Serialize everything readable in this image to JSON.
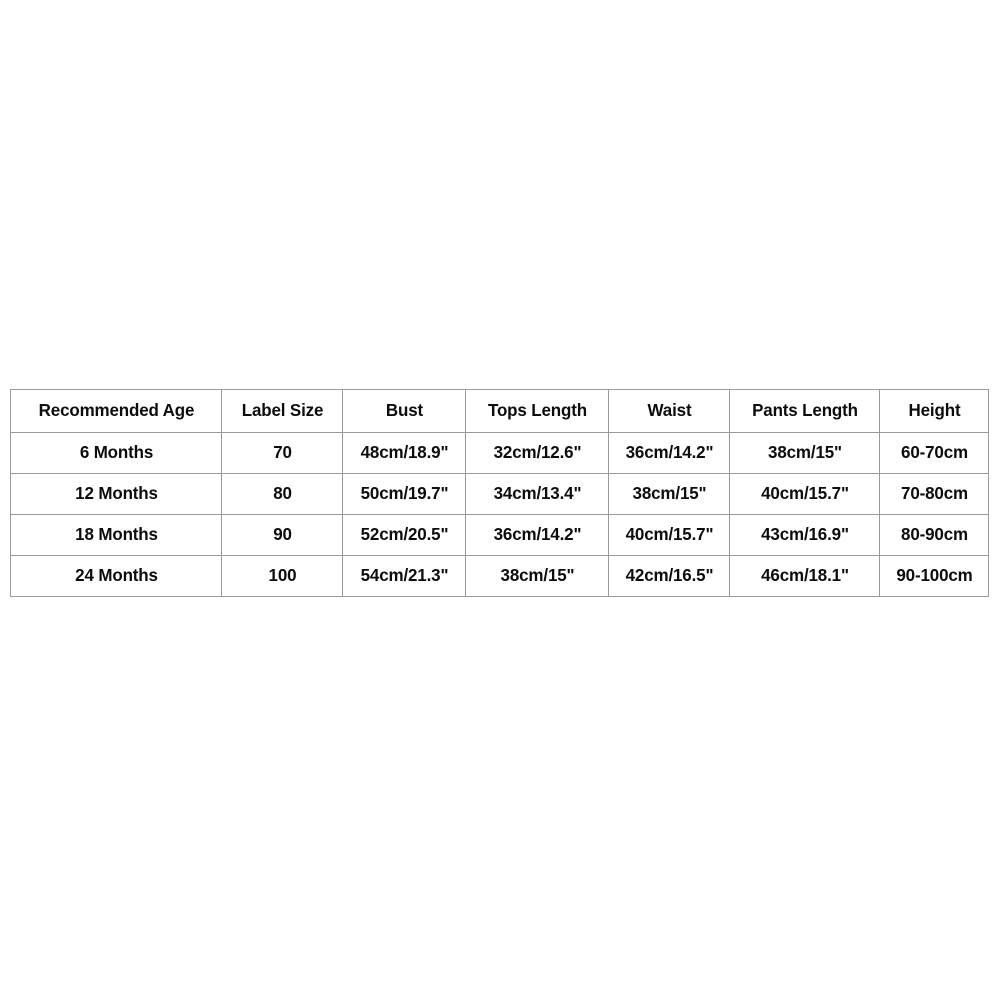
{
  "page": {
    "background_color": "#ffffff",
    "text_color": "#0d0d0d",
    "border_color": "#9a9a9a"
  },
  "table": {
    "name": "baby-clothing-size-chart",
    "columns": [
      {
        "key": "age",
        "label": "Recommended Age"
      },
      {
        "key": "label",
        "label": "Label Size"
      },
      {
        "key": "bust",
        "label": "Bust"
      },
      {
        "key": "tops",
        "label": "Tops Length"
      },
      {
        "key": "waist",
        "label": "Waist"
      },
      {
        "key": "pants",
        "label": "Pants Length"
      },
      {
        "key": "height",
        "label": "Height"
      }
    ],
    "rows": [
      {
        "age": "6 Months",
        "label": "70",
        "bust": "48cm/18.9\"",
        "tops": "32cm/12.6\"",
        "waist": "36cm/14.2\"",
        "pants": "38cm/15\"",
        "height": "60-70cm"
      },
      {
        "age": "12 Months",
        "label": "80",
        "bust": "50cm/19.7\"",
        "tops": "34cm/13.4\"",
        "waist": "38cm/15\"",
        "pants": "40cm/15.7\"",
        "height": "70-80cm"
      },
      {
        "age": "18 Months",
        "label": "90",
        "bust": "52cm/20.5\"",
        "tops": "36cm/14.2\"",
        "waist": "40cm/15.7\"",
        "pants": "43cm/16.9\"",
        "height": "80-90cm"
      },
      {
        "age": "24 Months",
        "label": "100",
        "bust": "54cm/21.3\"",
        "tops": "38cm/15\"",
        "waist": "42cm/16.5\"",
        "pants": "46cm/18.1\"",
        "height": "90-100cm"
      }
    ]
  }
}
